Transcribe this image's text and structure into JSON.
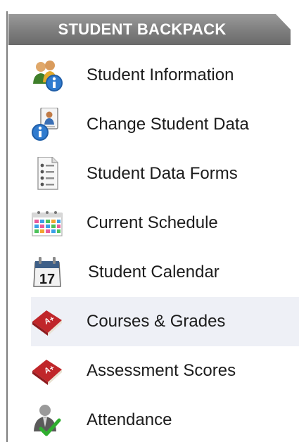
{
  "panel": {
    "title": "STUDENT BACKPACK",
    "accent_color": "#7a7a7a",
    "active_background": "#eef0f6"
  },
  "menu": {
    "items": [
      {
        "label": "Student Information",
        "icon": "student-info-icon"
      },
      {
        "label": "Change Student Data",
        "icon": "change-data-icon"
      },
      {
        "label": "Student Data Forms",
        "icon": "data-forms-icon"
      },
      {
        "label": "Current Schedule",
        "icon": "schedule-calendar-icon"
      },
      {
        "label": "Student Calendar",
        "icon": "calendar-17-icon"
      },
      {
        "label": "Courses & Grades",
        "icon": "grades-book-icon",
        "active": true
      },
      {
        "label": "Assessment Scores",
        "icon": "grades-book-icon"
      },
      {
        "label": "Attendance",
        "icon": "attendance-person-icon"
      }
    ]
  }
}
